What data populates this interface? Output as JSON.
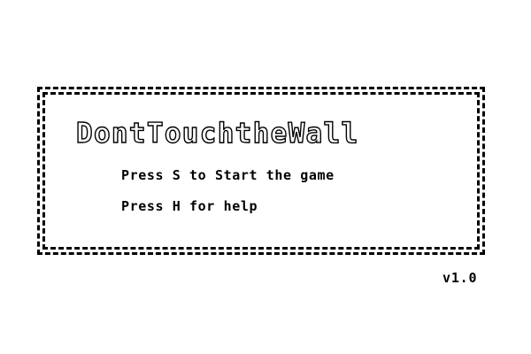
{
  "title_screen": {
    "title": "DontTouchtheWall",
    "start_prompt": "Press S to Start the game",
    "help_prompt": "Press H for help",
    "version": "v1.0"
  },
  "colors": {
    "background": "#ffffff",
    "foreground": "#000000"
  }
}
